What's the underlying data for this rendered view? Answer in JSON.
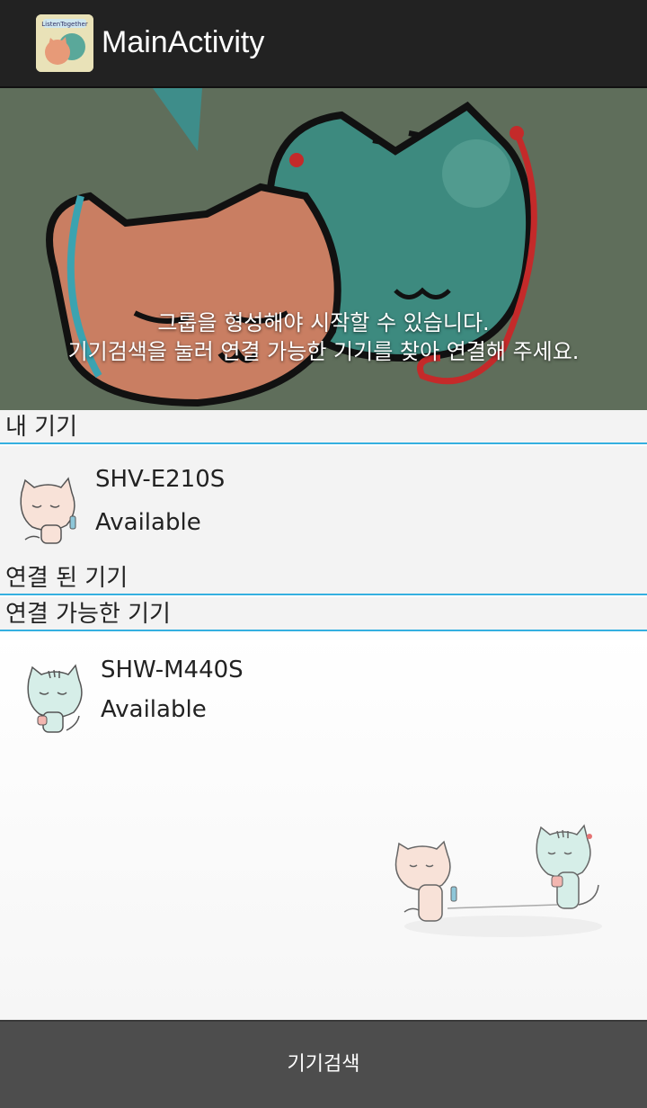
{
  "app": {
    "title": "MainActivity",
    "icon": "listen-together-cats-icon",
    "icon_text": "ListenTogether"
  },
  "banner": {
    "line1": "그룹을 형성해야 시작할 수 있습니다.",
    "line2": "기기검색을 눌러 연결 가능한 기기를 찾아 연결해 주세요."
  },
  "sections": {
    "my_device": "내 기기",
    "connected": "연결 된 기기",
    "available": "연결 가능한 기기"
  },
  "my_device": {
    "name": "SHV-E210S",
    "status": "Available",
    "avatar": "pink-cat-icon"
  },
  "available_devices": [
    {
      "name": "SHW-M440S",
      "status": "Available",
      "avatar": "mint-cat-icon"
    }
  ],
  "footer": {
    "search_button": "기기검색"
  },
  "colors": {
    "actionbar": "#222222",
    "divider": "#35b0e0",
    "button_bg": "#4d4d4d"
  }
}
